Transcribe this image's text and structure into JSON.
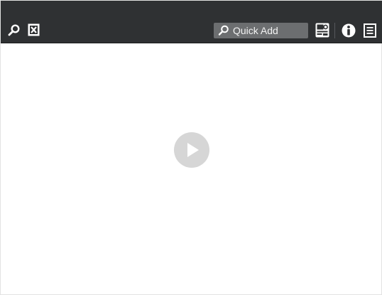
{
  "toolbar": {
    "left_icons": [
      "search-icon",
      "clear-filter-icon"
    ],
    "quick_add": {
      "label": "Quick Add",
      "icon": "search-icon"
    },
    "right_icons": [
      "calendar-icon",
      "info-icon",
      "notes-icon"
    ]
  },
  "content": {
    "play_icon": "play-icon"
  },
  "colors": {
    "toolbar_bg": "#2f3133",
    "quick_add_bg": "#6c6e70",
    "icon_fg": "#ffffff",
    "play_bg": "#d6d6d6",
    "content_bg": "#ffffff"
  }
}
